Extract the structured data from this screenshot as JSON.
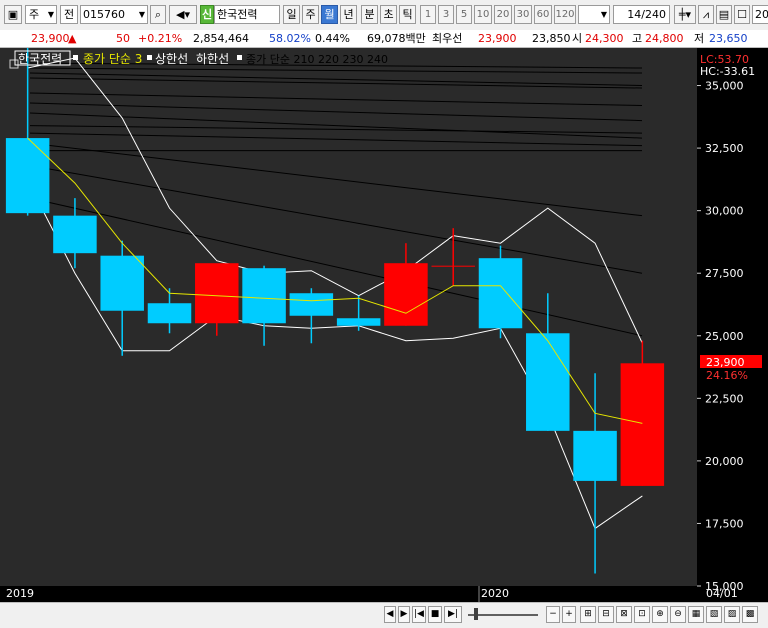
{
  "toolbar": {
    "period_select": "주",
    "market_label": "전",
    "stock_code": "015760",
    "badge_new": "신",
    "stock_name": "한국전력",
    "period_buttons": [
      "일",
      "주",
      "월",
      "년",
      "분",
      "초",
      "틱"
    ],
    "active_period": "월",
    "tick_numbers": [
      "1",
      "3",
      "5",
      "10",
      "20",
      "30",
      "60",
      "120"
    ],
    "count_display": "14",
    "count_total": "/240",
    "right_label": "20"
  },
  "infobar": {
    "price": "23,900",
    "change_arrow": "▲",
    "change": "50",
    "change_pct": "+0.21%",
    "volume": "2,854,464",
    "volume_ratio": "58.02%",
    "turnover": "0.44%",
    "amount": "69,078백만",
    "best_label": "최우선",
    "best_ask": "23,900",
    "best_bid": "23,850",
    "open_label": "시",
    "open": "24,300",
    "high_label": "고",
    "high": "24,800",
    "low_label": "저",
    "low": "23,650"
  },
  "legend": {
    "name": "한국전력",
    "ma_label": "종가 단순 3",
    "upper": "상한선",
    "lower": "하한선",
    "long_ma": "종가 단순 210 220 230 240"
  },
  "indicators": {
    "lc": "LC:53.70",
    "hc": "HC:-33.61"
  },
  "colors": {
    "up": "#ff0000",
    "down": "#00ccff",
    "ma": "#e6e600",
    "envelope": "#ffffff",
    "long_ma": "#000000"
  },
  "chart_data": {
    "type": "candlestick",
    "y_ticks": [
      "35,000",
      "32,500",
      "30,000",
      "27,500",
      "25,000",
      "22,500",
      "20,000",
      "17,500",
      "15,000"
    ],
    "ylim": [
      15000,
      36500
    ],
    "x_labels": [
      "2019",
      "2020",
      "04/01"
    ],
    "current_price_label": "23,900",
    "current_change_label": "24.16%",
    "candles": [
      {
        "open": 32900,
        "high": 37100,
        "low": 29800,
        "close": 29900
      },
      {
        "open": 29800,
        "high": 30500,
        "low": 27700,
        "close": 28300
      },
      {
        "open": 28200,
        "high": 28800,
        "low": 24200,
        "close": 26000
      },
      {
        "open": 26300,
        "high": 26900,
        "low": 25100,
        "close": 25500
      },
      {
        "open": 25500,
        "high": 27500,
        "low": 25000,
        "close": 27900
      },
      {
        "open": 27700,
        "high": 27800,
        "low": 24600,
        "close": 25500
      },
      {
        "open": 26700,
        "high": 26900,
        "low": 24700,
        "close": 25800
      },
      {
        "open": 25700,
        "high": 26600,
        "low": 25200,
        "close": 25400
      },
      {
        "open": 25400,
        "high": 28700,
        "low": 25400,
        "close": 27900
      },
      {
        "open": 27800,
        "high": 29300,
        "low": 27000,
        "close": 27800
      },
      {
        "open": 28100,
        "high": 28600,
        "low": 24900,
        "close": 25300
      },
      {
        "open": 25100,
        "high": 26700,
        "low": 21200,
        "close": 21200
      },
      {
        "open": 21200,
        "high": 23500,
        "low": 15500,
        "close": 19200
      },
      {
        "open": 19000,
        "high": 24800,
        "low": 19000,
        "close": 23900
      }
    ],
    "ma3": [
      32900,
      31100,
      28700,
      26700,
      26600,
      26500,
      26400,
      26500,
      25900,
      27000,
      27000,
      24800,
      21900,
      21500
    ],
    "upper_env": [
      35700,
      36100,
      33700,
      30100,
      28000,
      27500,
      27600,
      26600,
      27600,
      29000,
      28700,
      30100,
      28700,
      24700
    ],
    "lower_env": [
      31200,
      27500,
      24400,
      24400,
      25800,
      25400,
      25300,
      25400,
      24800,
      24900,
      25300,
      21900,
      17300,
      18600
    ],
    "long_ma_lines": [
      [
        35900,
        35700
      ],
      [
        35700,
        35500
      ],
      [
        35500,
        35000
      ],
      [
        35300,
        34900
      ],
      [
        34700,
        34200
      ],
      [
        34300,
        33600
      ],
      [
        33900,
        32900
      ],
      [
        33400,
        33100
      ],
      [
        33100,
        32600
      ],
      [
        32700,
        29800
      ],
      [
        31800,
        27500
      ],
      [
        30500,
        25000
      ],
      [
        32400,
        32400
      ]
    ]
  },
  "bottombar": {
    "nav_buttons": [
      "◀",
      "▶",
      "|◀",
      "■",
      "▶|"
    ]
  }
}
